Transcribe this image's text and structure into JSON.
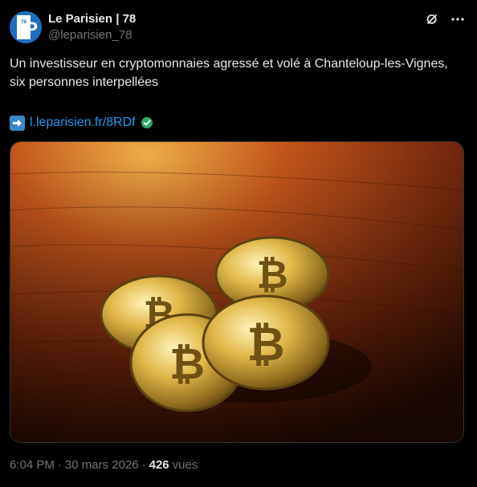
{
  "author": {
    "display_name": "Le Parisien | 78",
    "handle": "@leparisien_78",
    "avatar_text": "78",
    "avatar_letter": "P"
  },
  "tweet": {
    "text": "Un investisseur en cryptomonnaies agressé et volé à Chanteloup-les-Vignes, six personnes interpellées",
    "link_text": "l.leparisien.fr/8RDf"
  },
  "meta": {
    "time": "6:04 PM",
    "separator1": "·",
    "date": "30 mars 2026",
    "separator2": "·",
    "views_count": "426",
    "views_label": "vues"
  },
  "colors": {
    "background": "#000000",
    "text": "#e7e9ea",
    "secondary": "#71767b",
    "link": "#1d9bf0",
    "avatar_blue": "#1d6fbf"
  },
  "icons": {
    "grok": "grok-icon",
    "more": "more-icon",
    "arrow": "right-arrow-emoji-icon",
    "verified": "verified-check-icon"
  }
}
